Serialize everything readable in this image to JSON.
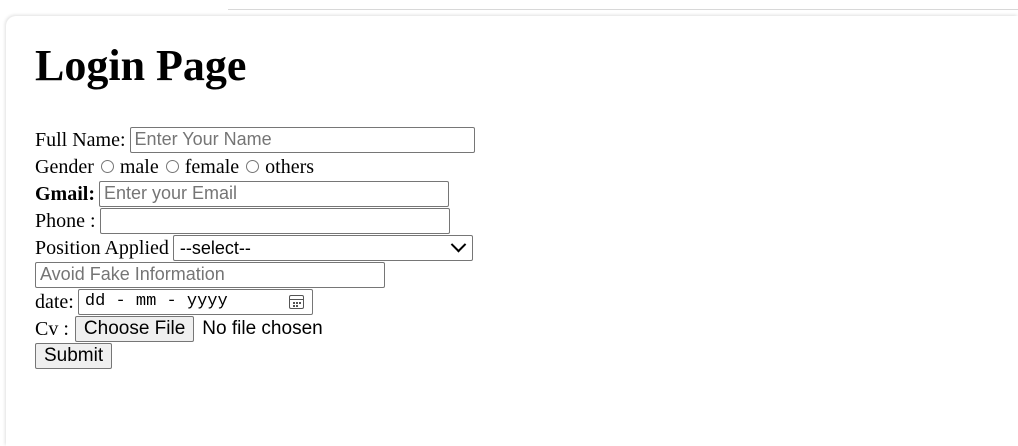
{
  "page": {
    "title": "Login Page"
  },
  "form": {
    "full_name": {
      "label": "Full Name:",
      "placeholder": "Enter Your Name",
      "value": ""
    },
    "gender": {
      "label": "Gender",
      "options": [
        "male",
        "female",
        "others"
      ]
    },
    "gmail": {
      "label": "Gmail:",
      "placeholder": "Enter your Email",
      "value": ""
    },
    "phone": {
      "label": "Phone :",
      "value": ""
    },
    "position": {
      "label": "Position Applied",
      "selected": "--select--"
    },
    "note": {
      "placeholder": "Avoid Fake Information",
      "value": ""
    },
    "date": {
      "label": "date:",
      "value": "dd - mm - yyyy"
    },
    "cv": {
      "label": "Cv :",
      "button_label": "Choose File",
      "status": "No file chosen"
    },
    "submit_label": "Submit"
  },
  "icons": {
    "select_chevron": "chevron-down-icon",
    "date_picker": "calendar-icon"
  },
  "colors": {
    "input_border": "#767676",
    "button_background": "#efefef",
    "placeholder_text": "#757575"
  }
}
